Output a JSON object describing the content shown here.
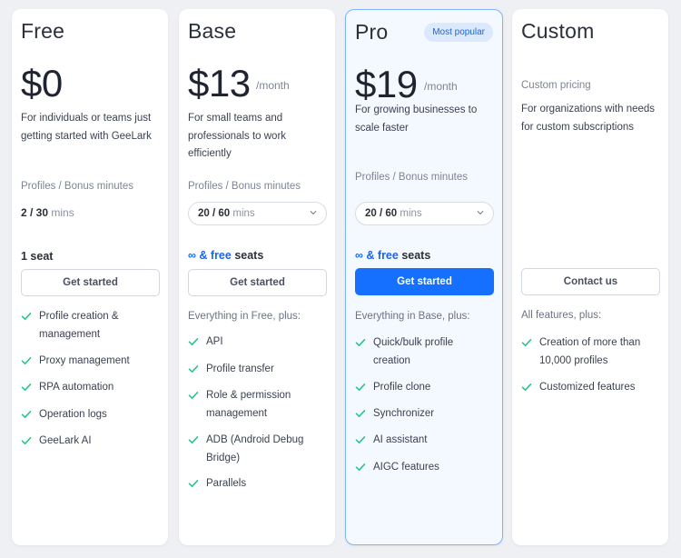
{
  "accent_color": "#1570ff",
  "check_color": "#2bc48a",
  "plans": [
    {
      "name": "Free",
      "price": "$0",
      "description": "For individuals or teams just getting started with GeeLark",
      "profiles_label": "Profiles / Bonus minutes",
      "profiles_value": "2 / 30",
      "profiles_unit": "mins",
      "seats": "1 seat",
      "button": "Get started",
      "features": [
        "Profile creation & management",
        "Proxy management",
        "RPA automation",
        "Operation logs",
        "GeeLark AI"
      ]
    },
    {
      "name": "Base",
      "price": "$13",
      "period": "/month",
      "description": "For small teams and professionals to work efficiently",
      "profiles_label": "Profiles / Bonus minutes",
      "profiles_value": "20 / 60",
      "profiles_unit": "mins",
      "seats_infinity": "∞",
      "seats_free": "& free",
      "seats_word": "seats",
      "button": "Get started",
      "plus_text": "Everything in Free, plus:",
      "features": [
        "API",
        "Profile transfer",
        "Role & permission management",
        "ADB (Android Debug Bridge)",
        "Parallels"
      ]
    },
    {
      "name": "Pro",
      "badge": "Most popular",
      "price": "$19",
      "period": "/month",
      "description": "For growing businesses to scale faster",
      "profiles_label": "Profiles / Bonus minutes",
      "profiles_value": "20 / 60",
      "profiles_unit": "mins",
      "seats_infinity": "∞",
      "seats_free": "& free",
      "seats_word": "seats",
      "button": "Get started",
      "plus_text": "Everything in Base, plus:",
      "features": [
        "Quick/bulk profile creation",
        "Profile clone",
        "Synchronizer",
        "AI assistant",
        "AIGC features"
      ]
    },
    {
      "name": "Custom",
      "pricing_label": "Custom pricing",
      "description": "For organizations with needs for custom subscriptions",
      "button": "Contact us",
      "plus_text": "All features, plus:",
      "features": [
        "Creation of more than 10,000 profiles",
        "Customized features"
      ]
    }
  ]
}
